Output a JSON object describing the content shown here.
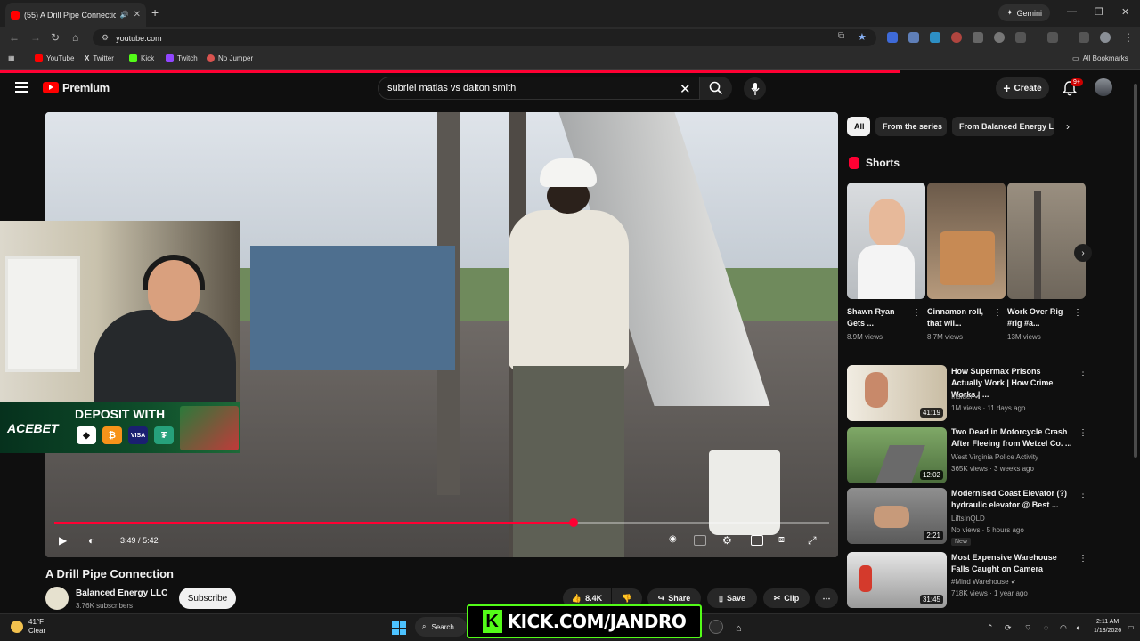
{
  "browser": {
    "tab_title": "(55) A Drill Pipe Connection",
    "new_tab": "+",
    "gemini_label": "Gemini",
    "url": "youtube.com",
    "bookmarks": [
      "YouTube",
      "Twitter",
      "Kick",
      "Twitch",
      "No Jumper"
    ],
    "all_bookmarks": "All Bookmarks",
    "page_load_progress": 0.79
  },
  "youtube": {
    "logo_text": "Premium",
    "search_query": "subriel matias vs dalton smith",
    "create_label": "Create",
    "notifications_badge": "9+"
  },
  "player": {
    "current_time": "3:49",
    "duration": "5:42",
    "time_separator": "/",
    "progress_fraction": 0.67
  },
  "overlay": {
    "ad_brand": "ACEBET",
    "ad_text": "DEPOSIT WITH",
    "stream_banner": "KICK.COM/JANDRO"
  },
  "video": {
    "title": "A Drill Pipe Connection",
    "channel": "Balanced Energy LLC",
    "subscribers": "3.76K subscribers",
    "subscribe_label": "Subscribe",
    "likes": "8.4K",
    "share_label": "Share",
    "save_label": "Save",
    "clip_label": "Clip"
  },
  "chips": [
    "All",
    "From the series",
    "From Balanced Energy LLC"
  ],
  "shorts": {
    "heading": "Shorts",
    "items": [
      {
        "title": "Shawn Ryan Gets ...",
        "views": "8.9M views"
      },
      {
        "title": "Cinnamon roll, that wil...",
        "views": "8.7M views"
      },
      {
        "title": "Work Over Rig #rig #a...",
        "views": "13M views"
      }
    ]
  },
  "related": [
    {
      "title": "How Supermax Prisons Actually Work | How Crime Works | ...",
      "channel": "Insider",
      "meta": "1M views · 11 days ago",
      "duration": "41:19"
    },
    {
      "title": "Two Dead in Motorcycle Crash After Fleeing from Wetzel Co. ...",
      "channel": "West Virginia Police Activity",
      "meta": "365K views · 3 weeks ago",
      "duration": "12:02"
    },
    {
      "title": "Modernised Coast Elevator (?) hydraulic elevator @ Best ...",
      "channel": "LiftsInQLD",
      "meta": "No views · 5 hours ago",
      "duration": "2:21",
      "tag": "New"
    },
    {
      "title": "Most Expensive Warehouse Falls Caught on Camera",
      "channel": "#Mind Warehouse",
      "meta": "718K views · 1 year ago",
      "duration": "31:45"
    }
  ],
  "taskbar": {
    "temperature": "41°F",
    "condition": "Clear",
    "search_label": "Search",
    "time": "2:11 AM",
    "date": "1/13/2026"
  }
}
